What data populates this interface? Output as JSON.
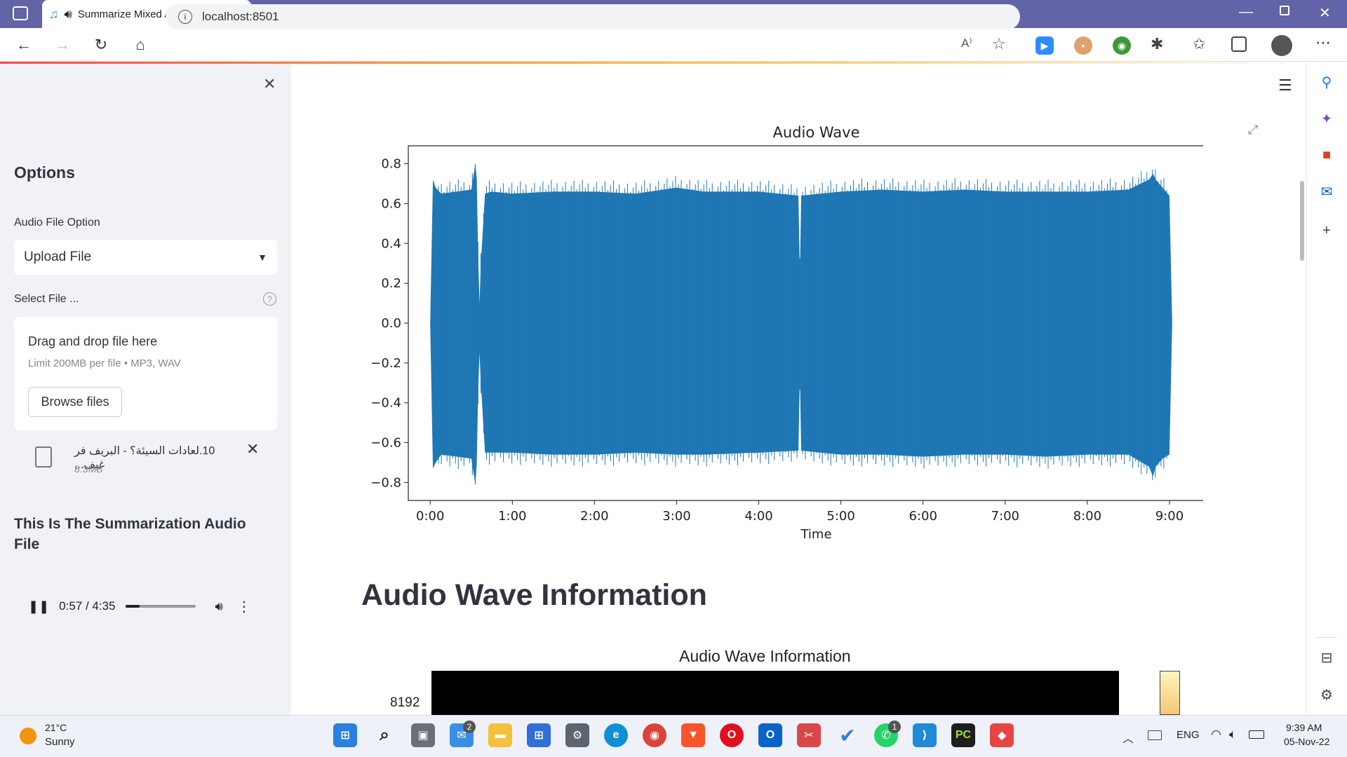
{
  "browser": {
    "tab_title": "Summarize Mixed Audio",
    "url": "localhost:8501"
  },
  "sidebar": {
    "heading": "Options",
    "audio_option_label": "Audio File Option",
    "audio_option_value": "Upload File",
    "select_file_label": "Select File ...",
    "uploader": {
      "drag_text": "Drag and drop file here",
      "limit_text": "Limit 200MB per file • MP3, WAV",
      "browse_label": "Browse files"
    },
    "uploaded_file": {
      "name": "10.لعادات السيئة؟ - البريف فر غيف...",
      "size": "8.3MB"
    },
    "summary_heading": "This Is The Summarization Audio File",
    "player": {
      "time": "0:57 / 4:35",
      "progress": 0.207
    }
  },
  "main": {
    "section_heading": "Audio Wave Information",
    "spectrogram": {
      "title": "Audio Wave Information",
      "first_ytick": "8192"
    }
  },
  "chart_data": {
    "type": "line",
    "title": "Audio Wave",
    "xlabel": "Time",
    "ylabel": "",
    "x_ticks": [
      "0:00",
      "1:00",
      "2:00",
      "3:00",
      "4:00",
      "5:00",
      "6:00",
      "7:00",
      "8:00",
      "9:00"
    ],
    "y_ticks": [
      "0.8",
      "0.6",
      "0.4",
      "0.2",
      "0.0",
      "−0.2",
      "−0.4",
      "−0.6",
      "−0.8"
    ],
    "xlim_seconds": [
      -16,
      580
    ],
    "ylim": [
      -0.89,
      0.89
    ],
    "series": [
      {
        "color": "#1f77b4",
        "envelope": {
          "time_seconds": [
            0,
            2,
            4,
            8,
            30,
            33,
            34,
            35,
            36,
            37,
            40,
            45,
            60,
            90,
            120,
            150,
            180,
            200,
            240,
            269,
            270,
            271,
            300,
            330,
            360,
            390,
            420,
            450,
            480,
            510,
            525,
            528,
            530,
            535,
            540,
            542
          ],
          "upper": [
            0.0,
            0.72,
            0.68,
            0.65,
            0.67,
            0.8,
            0.72,
            0.35,
            0.1,
            0.3,
            0.65,
            0.66,
            0.65,
            0.66,
            0.66,
            0.65,
            0.68,
            0.66,
            0.66,
            0.64,
            0.24,
            0.64,
            0.66,
            0.67,
            0.66,
            0.67,
            0.66,
            0.66,
            0.66,
            0.67,
            0.72,
            0.75,
            0.72,
            0.68,
            0.64,
            0.0
          ],
          "lower": [
            0.0,
            -0.73,
            -0.7,
            -0.66,
            -0.68,
            -0.81,
            -0.7,
            -0.35,
            -0.15,
            -0.3,
            -0.65,
            -0.65,
            -0.65,
            -0.66,
            -0.66,
            -0.65,
            -0.66,
            -0.66,
            -0.65,
            -0.64,
            -0.25,
            -0.64,
            -0.66,
            -0.66,
            -0.67,
            -0.66,
            -0.66,
            -0.67,
            -0.66,
            -0.66,
            -0.72,
            -0.77,
            -0.72,
            -0.68,
            -0.66,
            0.0
          ]
        }
      }
    ],
    "grid": false
  },
  "taskbar": {
    "weather_temp": "21°C",
    "weather_desc": "Sunny",
    "language": "ENG",
    "time": "9:39 AM",
    "date": "05-Nov-22",
    "mail_badge": "2",
    "whatsapp_badge": "1"
  }
}
